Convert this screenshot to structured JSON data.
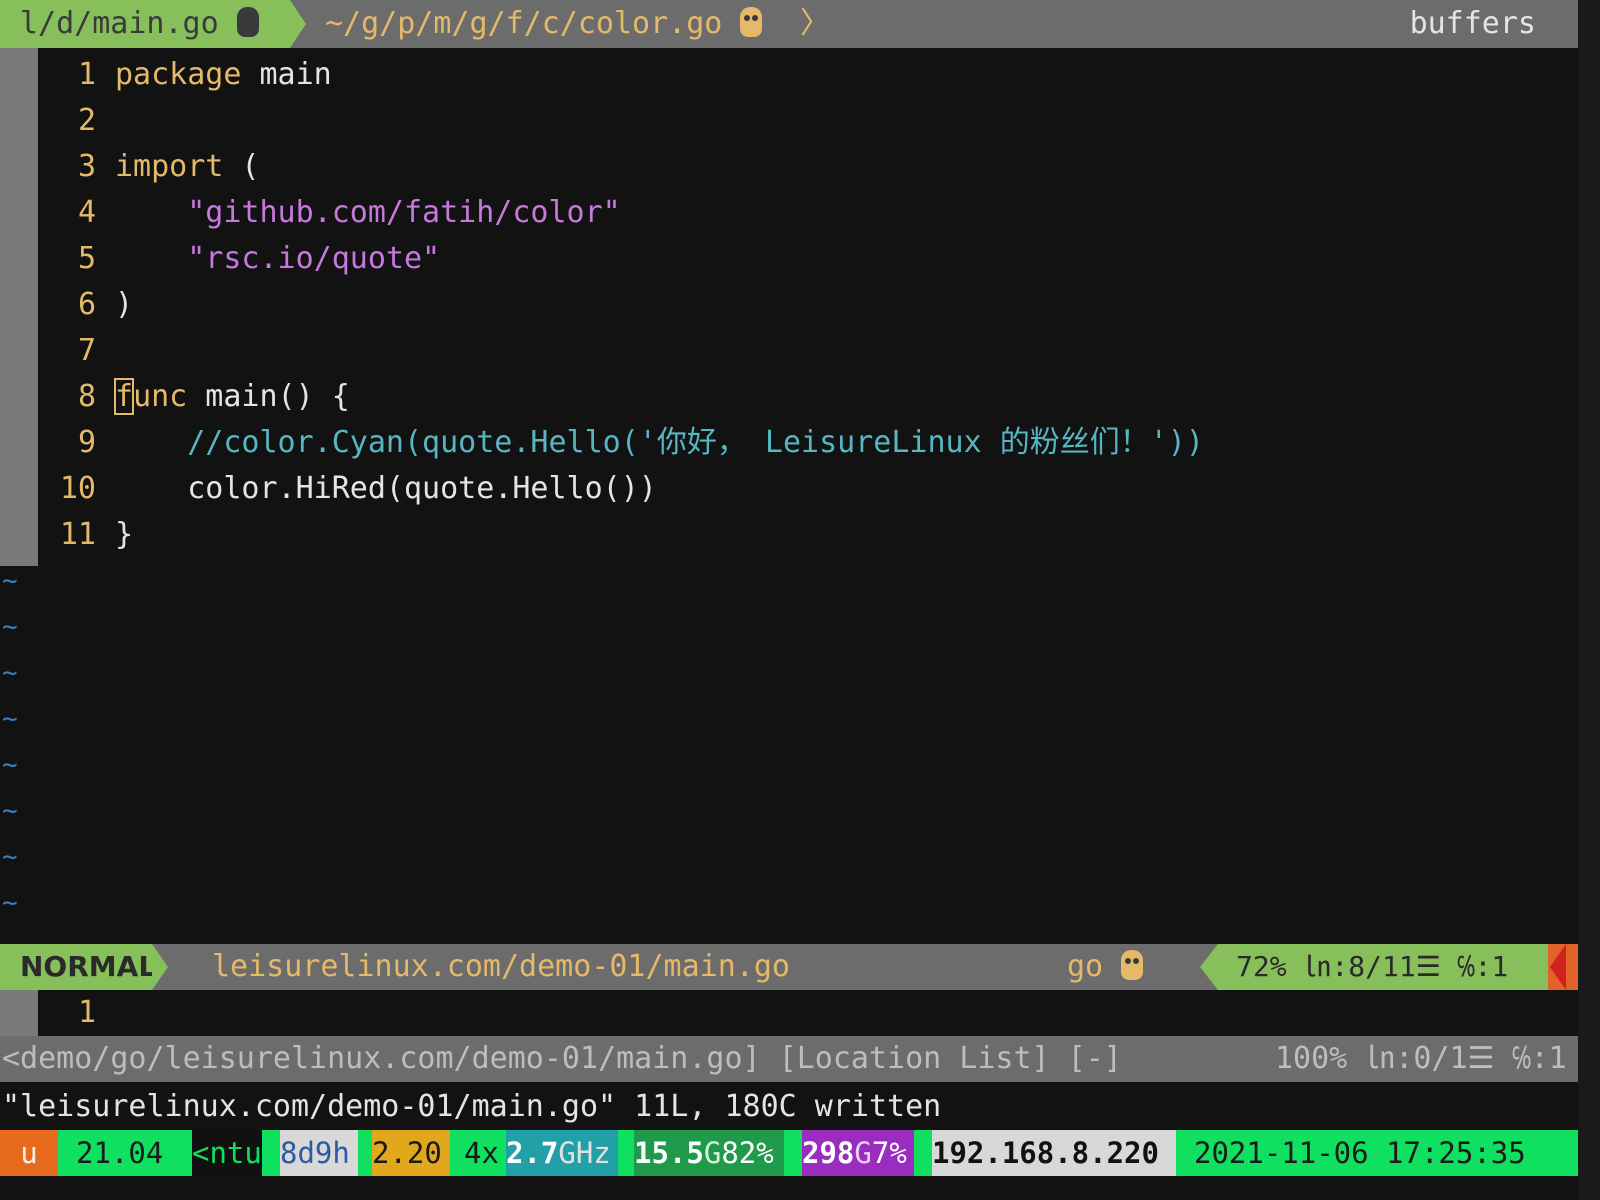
{
  "tabline": {
    "active_tab": "l/d/main.go",
    "inactive_tab": "~/g/p/m/g/f/c/color.go",
    "tab_separator": "〉",
    "buffers_label": "buffers"
  },
  "editor": {
    "lines": [
      {
        "num": "1",
        "kw": "package",
        "rest": " main"
      },
      {
        "num": "2",
        "kw": "",
        "rest": ""
      },
      {
        "num": "3",
        "kw": "import",
        "rest": " ("
      },
      {
        "num": "4",
        "indent": "    ",
        "str": "\"github.com/fatih/color\""
      },
      {
        "num": "5",
        "indent": "    ",
        "str": "\"rsc.io/quote\""
      },
      {
        "num": "6",
        "kw": "",
        "rest": ")"
      },
      {
        "num": "7",
        "kw": "",
        "rest": ""
      },
      {
        "num": "8",
        "cursor_char": "f",
        "kw": "unc",
        "rest": " main() {"
      },
      {
        "num": "9",
        "indent": "    ",
        "comment": "//color.Cyan(quote.Hello('你好， LeisureLinux 的粉丝们！'))"
      },
      {
        "num": "10",
        "indent": "    ",
        "rest": "color.HiRed(quote.Hello())"
      },
      {
        "num": "11",
        "kw": "",
        "rest": "}"
      }
    ],
    "empty_line_marker": "~"
  },
  "statusline": {
    "mode": "NORMAL",
    "file_path": "leisurelinux.com/demo-01/main.go",
    "filetype": "go",
    "position": "72% ㏑:8/11☰ ℅:1"
  },
  "location_list": {
    "line_number": "1",
    "status_left": "<demo/go/leisurelinux.com/demo-01/main.go] [Location List] [-]",
    "status_right": "100% ㏑:0/1☰ ℅:1"
  },
  "message": "\"leisurelinux.com/demo-01/main.go\" 11L, 180C written",
  "tmux_bar": {
    "session": "u",
    "os_version": "21.04",
    "host": "<ntu>",
    "uptime": "8d9h",
    "load": "2.20",
    "cpu_count": "4x",
    "cpu_freq_value": "2.7",
    "cpu_freq_unit": "GHz",
    "mem_value": "15.5",
    "mem_unit": "G",
    "mem_pct": "82%",
    "disk_value": "298",
    "disk_unit": "G",
    "disk_pct": "7%",
    "ip": "192.168.8.220",
    "datetime": "2021-11-06 17:25:35"
  },
  "colors": {
    "background": "#121212",
    "keyword": "#e5b96a",
    "string": "#c678dd",
    "comment": "#56b6c2",
    "mode_green": "#87c05a",
    "tmux_green": "#10e060"
  }
}
